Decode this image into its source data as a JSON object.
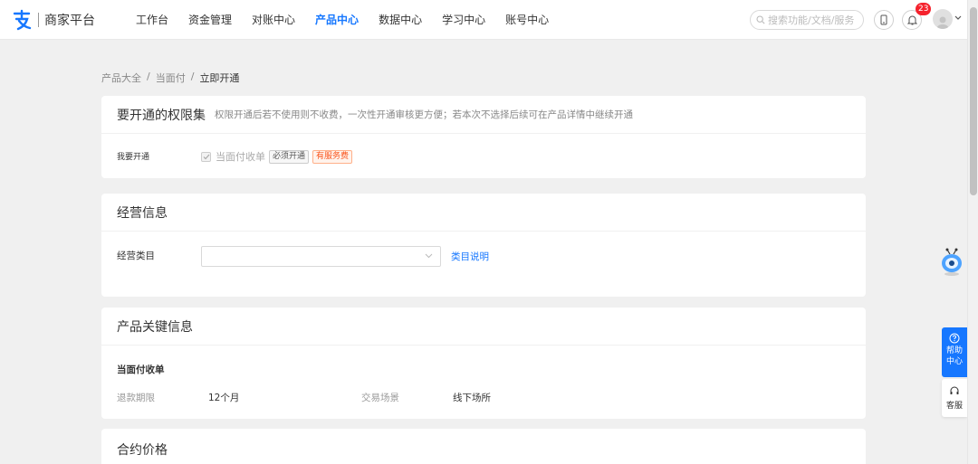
{
  "brand": {
    "name": "商家平台"
  },
  "nav": [
    {
      "label": "工作台",
      "active": false
    },
    {
      "label": "资金管理",
      "active": false
    },
    {
      "label": "对账中心",
      "active": false
    },
    {
      "label": "产品中心",
      "active": true
    },
    {
      "label": "数据中心",
      "active": false
    },
    {
      "label": "学习中心",
      "active": false
    },
    {
      "label": "账号中心",
      "active": false
    }
  ],
  "search": {
    "placeholder": "搜索功能/文档/服务"
  },
  "notifications": {
    "count": "23"
  },
  "breadcrumb": {
    "item1": "产品大全",
    "sep": "/",
    "item2": "当面付",
    "current": "立即开通"
  },
  "permissions": {
    "title": "要开通的权限集",
    "desc": "权限开通后若不使用则不收费，一次性开通审核更方便；若本次不选择后续可在产品详情中继续开通",
    "row_label": "我要开通",
    "checkbox_label": "当面付收单",
    "checked": true,
    "tag_required": "必须开通",
    "tag_fee": "有服务费"
  },
  "business": {
    "title": "经营信息",
    "category_label": "经营类目",
    "category_value": "",
    "category_link": "类目说明"
  },
  "key_info": {
    "title": "产品关键信息",
    "subtitle": "当面付收单",
    "refund_label": "退款期限",
    "refund_value": "12个月",
    "scene_label": "交易场景",
    "scene_value": "线下场所"
  },
  "pricing": {
    "title": "合约价格"
  },
  "side": {
    "help": "帮助中心",
    "cs": "客服"
  },
  "colors": {
    "accent": "#1677ff",
    "badge": "#f5222d",
    "fee_tag": "#fa541c"
  }
}
